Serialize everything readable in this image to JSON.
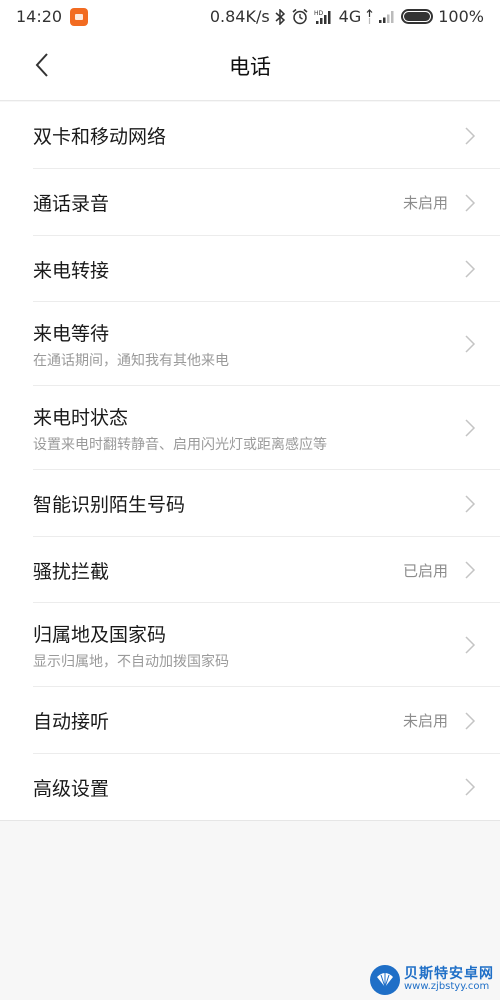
{
  "status_bar": {
    "time": "14:20",
    "notification_icon": "mi-app-notification-icon",
    "net_speed": "0.84K/s",
    "icons": [
      "bluetooth-icon",
      "alarm-icon",
      "hd-signal-icon",
      "signal-sim2-icon"
    ],
    "network_type": "4G",
    "battery_percent": "100%",
    "battery_level": 1.0
  },
  "header": {
    "back_icon": "chevron-left-icon",
    "title": "电话"
  },
  "settings": [
    {
      "title": "双卡和移动网络",
      "subtitle": null,
      "value": null
    },
    {
      "title": "通话录音",
      "subtitle": null,
      "value": "未启用"
    },
    {
      "title": "来电转接",
      "subtitle": null,
      "value": null
    },
    {
      "title": "来电等待",
      "subtitle": "在通话期间，通知我有其他来电",
      "value": null
    },
    {
      "title": "来电时状态",
      "subtitle": "设置来电时翻转静音、启用闪光灯或距离感应等",
      "value": null
    },
    {
      "title": "智能识别陌生号码",
      "subtitle": null,
      "value": null
    },
    {
      "title": "骚扰拦截",
      "subtitle": null,
      "value": "已启用"
    },
    {
      "title": "归属地及国家码",
      "subtitle": "显示归属地，不自动加拨国家码",
      "value": null
    },
    {
      "title": "自动接听",
      "subtitle": null,
      "value": "未启用"
    },
    {
      "title": "高级设置",
      "subtitle": null,
      "value": null
    }
  ],
  "watermark": {
    "name": "贝斯特安卓网",
    "url": "www.zjbstyy.com"
  },
  "colors": {
    "accent_notification": "#f26b21",
    "watermark_blue": "#1f6fc7",
    "background": "#f7f7f7"
  }
}
